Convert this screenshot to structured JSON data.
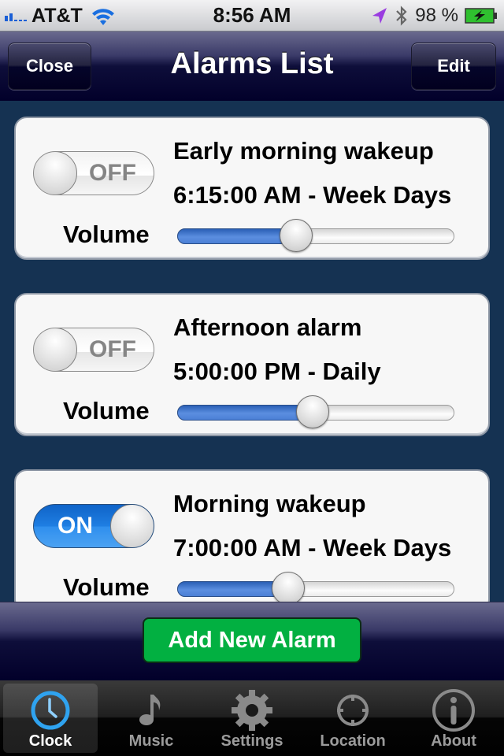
{
  "status_bar": {
    "carrier": "AT&T",
    "time": "8:56 AM",
    "battery_percent": "98 %",
    "icons": [
      "signal-icon",
      "wifi-icon",
      "location-arrow-icon",
      "bluetooth-icon",
      "battery-charging-icon"
    ]
  },
  "nav": {
    "title": "Alarms List",
    "close_label": "Close",
    "edit_label": "Edit"
  },
  "alarms": [
    {
      "name": "Early morning wakeup",
      "schedule": "6:15:00 AM - Week Days",
      "enabled": false,
      "toggle_label": "OFF",
      "volume_label": "Volume",
      "volume": 0.43
    },
    {
      "name": "Afternoon alarm",
      "schedule": "5:00:00 PM - Daily",
      "enabled": false,
      "toggle_label": "OFF",
      "volume_label": "Volume",
      "volume": 0.49
    },
    {
      "name": "Morning wakeup",
      "schedule": "7:00:00 AM - Week Days",
      "enabled": true,
      "toggle_label": "ON",
      "volume_label": "Volume",
      "volume": 0.4
    }
  ],
  "toolbar": {
    "add_label": "Add New Alarm"
  },
  "tabs": [
    {
      "label": "Clock",
      "icon": "clock-icon",
      "active": true
    },
    {
      "label": "Music",
      "icon": "music-note-icon",
      "active": false
    },
    {
      "label": "Settings",
      "icon": "gear-icon",
      "active": false
    },
    {
      "label": "Location",
      "icon": "crosshair-icon",
      "active": false
    },
    {
      "label": "About",
      "icon": "info-icon",
      "active": false
    }
  ],
  "colors": {
    "accent_green": "#02b041",
    "toggle_on_blue": "#1f7ee2",
    "list_background": "#153252",
    "tab_active_icon": "#2fa3f0"
  }
}
